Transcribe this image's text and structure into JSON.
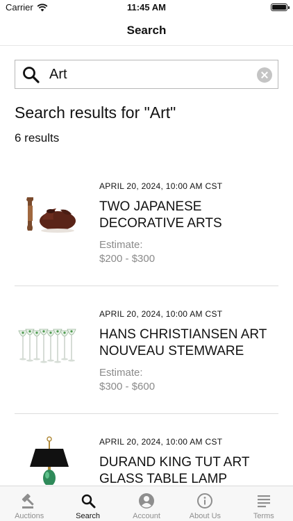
{
  "status_bar": {
    "carrier": "Carrier",
    "time": "11:45 AM"
  },
  "nav": {
    "title": "Search"
  },
  "search": {
    "query": "Art"
  },
  "results": {
    "heading": "Search results for \"Art\"",
    "count": "6 results",
    "items": [
      {
        "date": "APRIL 20, 2024, 10:00 AM CST",
        "title": "TWO JAPANESE DECORATIVE ARTS",
        "estimate_label": "Estimate:",
        "estimate": "$200 - $300",
        "thumbnail_icon": "vases-icon"
      },
      {
        "date": "APRIL 20, 2024, 10:00 AM CST",
        "title": "HANS CHRISTIANSEN ART NOUVEAU STEMWARE",
        "estimate_label": "Estimate:",
        "estimate": "$300 - $600",
        "thumbnail_icon": "stemware-icon"
      },
      {
        "date": "APRIL 20, 2024, 10:00 AM CST",
        "title": "DURAND KING TUT ART GLASS TABLE LAMP",
        "estimate_label": "",
        "estimate": "",
        "thumbnail_icon": "lamp-icon"
      }
    ]
  },
  "tabs": [
    {
      "label": "Auctions",
      "icon": "gavel-icon",
      "active": false
    },
    {
      "label": "Search",
      "icon": "search-icon",
      "active": true
    },
    {
      "label": "Account",
      "icon": "account-icon",
      "active": false
    },
    {
      "label": "About Us",
      "icon": "info-icon",
      "active": false
    },
    {
      "label": "Terms",
      "icon": "terms-icon",
      "active": false
    }
  ],
  "colors": {
    "text": "#111111",
    "muted": "#8a8a8a",
    "tab_inactive": "#8e8e8e",
    "divider": "#dcdcdc"
  }
}
